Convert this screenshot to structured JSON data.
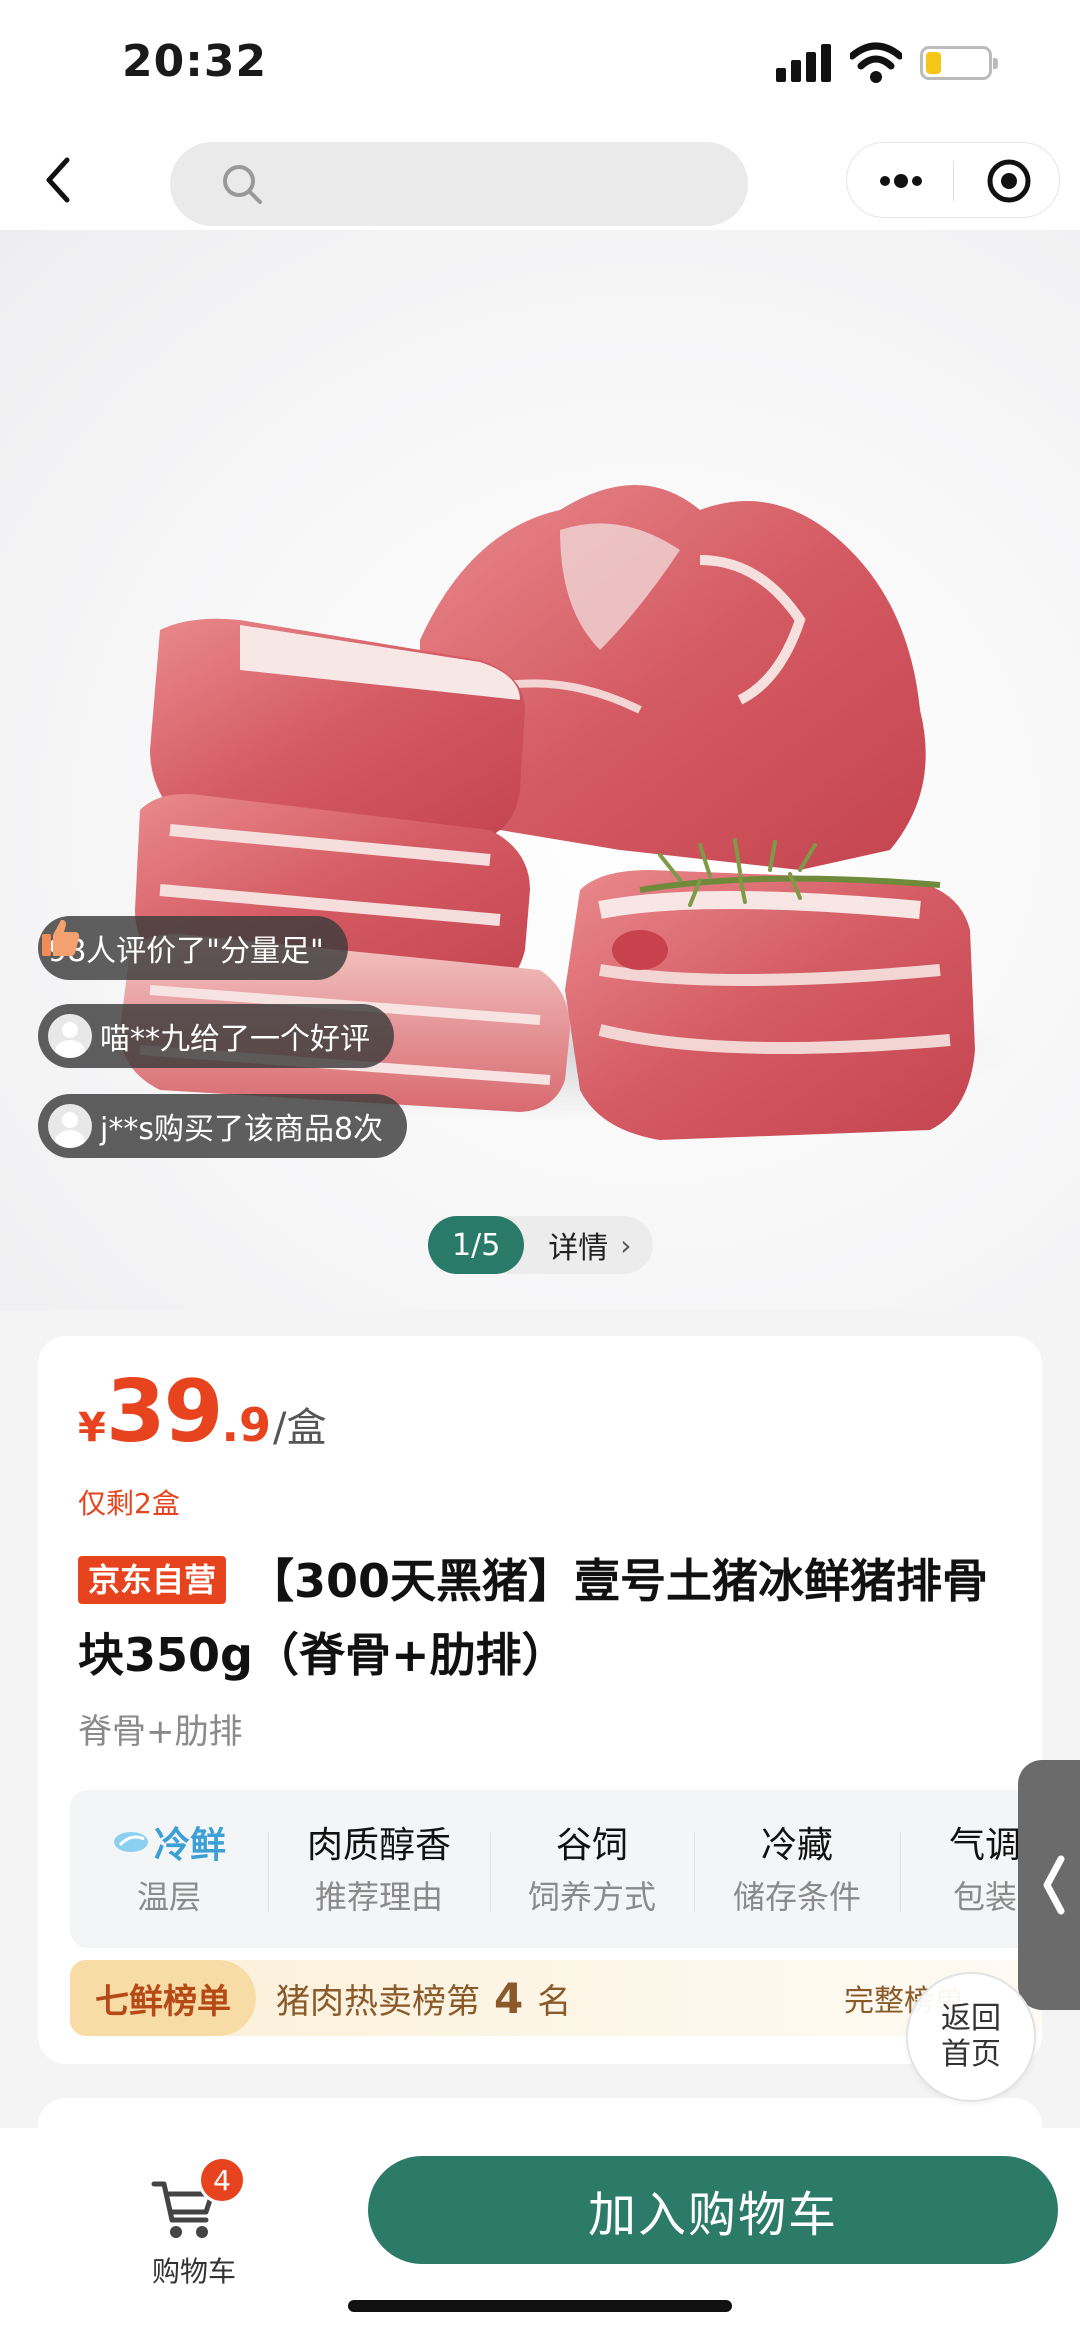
{
  "status_bar": {
    "time": "20:32",
    "battery_level": 0.25
  },
  "nav": {
    "back_icon": "back-chevron-icon",
    "search_icon": "search-icon",
    "more_icon": "more-icon",
    "target_icon": "target-icon"
  },
  "hero": {
    "bubbles": [
      {
        "icon": "thumbs-up-icon",
        "text": "98人评价了\"分量足\""
      },
      {
        "icon": "avatar-icon",
        "text": "喵**九给了一个好评"
      },
      {
        "icon": "avatar-icon",
        "text": "j**s购买了该商品8次"
      }
    ],
    "pager": {
      "index": "1/5",
      "detail": "详情"
    }
  },
  "product": {
    "price_currency": "¥",
    "price_integer": "39",
    "price_decimal": ".9",
    "price_unit": "/盒",
    "stock": "仅剩2盒",
    "badge": "京东自营",
    "title": "【300天黑猪】壹号土猪冰鲜猪排骨块350g（脊骨+肋排）",
    "subtitle": "脊骨+肋排",
    "attributes": [
      {
        "value": "冷鲜",
        "label": "温层"
      },
      {
        "value": "肉质醇香",
        "label": "推荐理由"
      },
      {
        "value": "谷饲",
        "label": "饲养方式"
      },
      {
        "value": "冷藏",
        "label": "储存条件"
      },
      {
        "value": "气调",
        "label": "包装"
      }
    ],
    "rank": {
      "tag": "七鲜榜单",
      "prefix": "猪肉热卖榜第",
      "number": "4",
      "suffix": "名",
      "full": "完整榜单"
    }
  },
  "floating": {
    "home_line1": "返回",
    "home_line2": "首页",
    "side_tab_icon": "chevron-left-icon"
  },
  "bottom": {
    "cart_label": "购物车",
    "cart_count": "4",
    "add_to_cart": "加入购物车"
  },
  "colors": {
    "price_red": "#e8431f",
    "brand_green": "#2c7a68",
    "cold_blue": "#3ba0d6"
  }
}
